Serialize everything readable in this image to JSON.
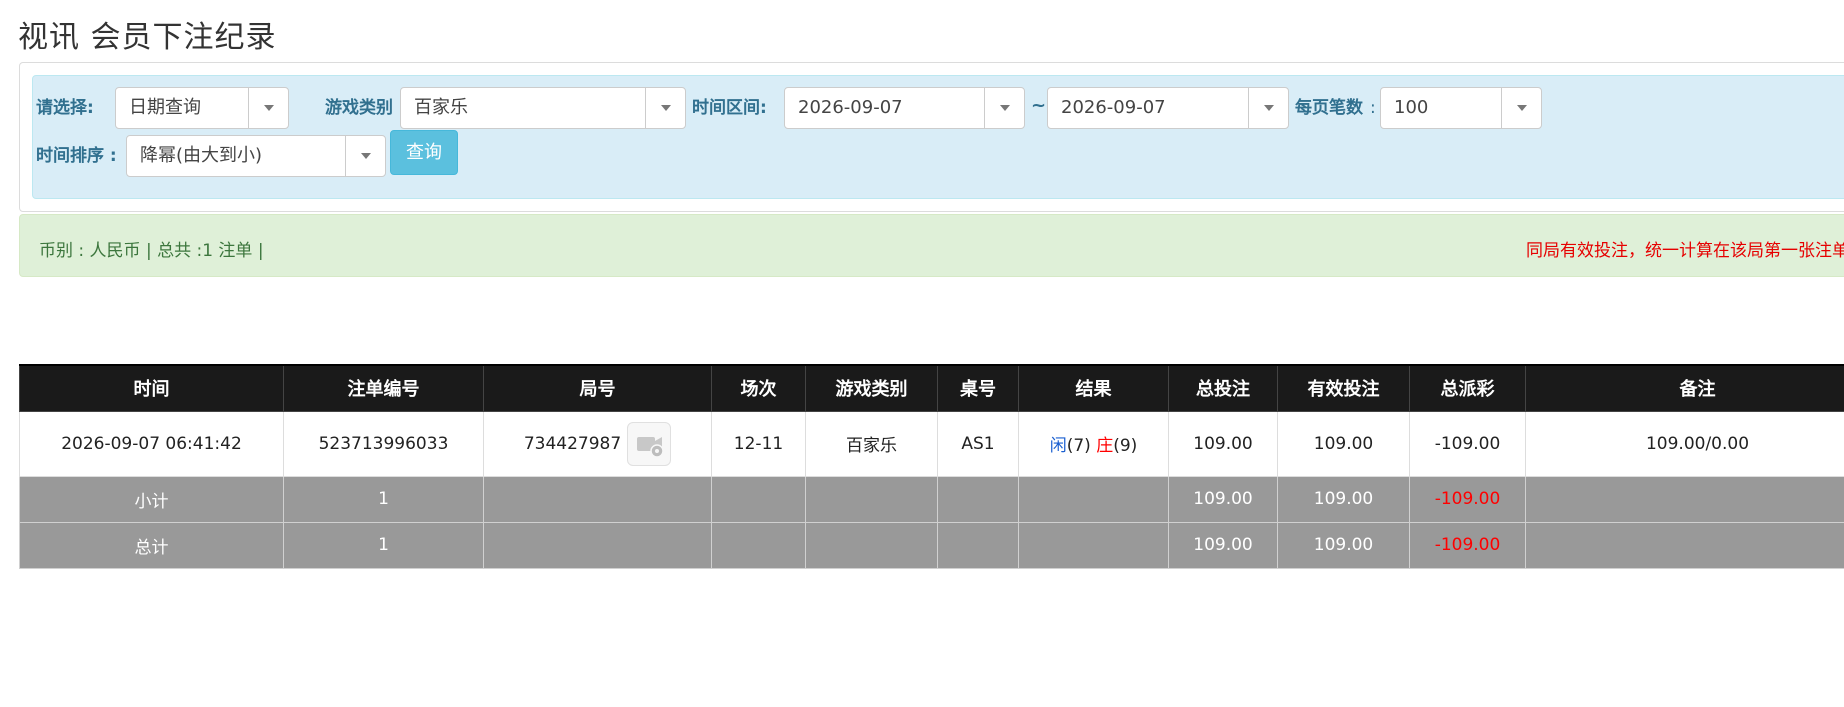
{
  "page": {
    "title": "视讯 会员下注纪录"
  },
  "filters": {
    "select_label": "请选择:",
    "select_value": "日期查询",
    "game_type_label": "游戏类别",
    "game_type_value": "百家乐",
    "time_range_label": "时间区间:",
    "date_from": "2026-09-07",
    "range_separator": "~",
    "date_to": "2026-09-07",
    "per_page_label": "每页笔数",
    "per_page_colon": ":",
    "per_page_value": "100",
    "sort_label": "时间排序 :",
    "sort_value": "降幂(由大到小)",
    "query_button": "查询"
  },
  "info": {
    "summary": "币别 : 人民币 | 总共 :1 注单 |",
    "note": "同局有效投注，统一计算在该局第一张注单"
  },
  "table": {
    "headers": [
      "时间",
      "注单编号",
      "局号",
      "场次",
      "游戏类别",
      "桌号",
      "结果",
      "总投注",
      "有效投注",
      "总派彩",
      "备注"
    ],
    "rows": [
      {
        "time": "2026-09-07 06:41:42",
        "bet_id": "523713996033",
        "round_no": "734427987",
        "session": "12-11",
        "game_type": "百家乐",
        "table_no": "AS1",
        "result_player_label": "闲",
        "result_player_value": "(7)",
        "result_banker_label": "庄",
        "result_banker_value": "(9)",
        "total_bet": "109.00",
        "valid_bet": "109.00",
        "payout": "-109.00",
        "remark": "109.00/0.00"
      }
    ],
    "subtotal": {
      "label": "小计",
      "count": "1",
      "total_bet": "109.00",
      "valid_bet": "109.00",
      "payout": "-109.00"
    },
    "grand_total": {
      "label": "总计",
      "count": "1",
      "total_bet": "109.00",
      "valid_bet": "109.00",
      "payout": "-109.00"
    }
  },
  "icons": {
    "round_video": "video-replay-icon",
    "dropdown": "chevron-down-icon"
  },
  "colors": {
    "header_bg": "#1a1a1a",
    "summary_bg": "#999999",
    "positive_blue": "#1a5fd0",
    "negative_red": "#ff0000",
    "info_bg": "#dff0d8",
    "filter_bg": "#d9edf7"
  }
}
